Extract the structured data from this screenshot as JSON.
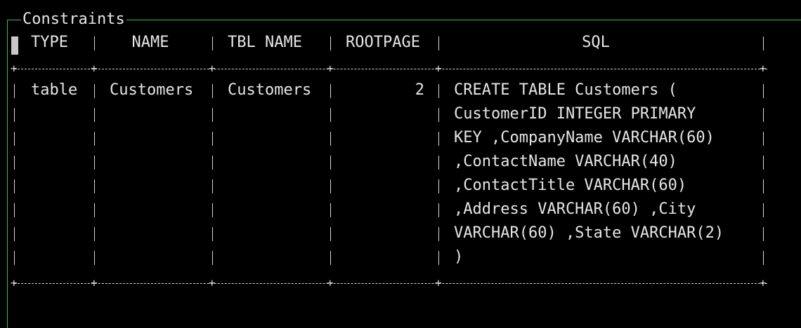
{
  "window": {
    "title": "Constraints"
  },
  "table": {
    "columns": [
      "TYPE",
      "NAME",
      "TBL NAME",
      "ROOTPAGE",
      "SQL"
    ],
    "rows": [
      {
        "type": "table",
        "name": "Customers",
        "tbl_name": "Customers",
        "rootpage": "2",
        "sql_lines": [
          "CREATE TABLE Customers (",
          "CustomerID INTEGER PRIMARY",
          "KEY ,CompanyName VARCHAR(60)",
          ",ContactName VARCHAR(40)",
          ",ContactTitle VARCHAR(60)",
          ",Address VARCHAR(60) ,City",
          "VARCHAR(60) ,State VARCHAR(2)",
          ")"
        ]
      }
    ]
  },
  "colors": {
    "background": "#000000",
    "frame_border": "#4fb84f",
    "text": "#e6e6e6"
  }
}
